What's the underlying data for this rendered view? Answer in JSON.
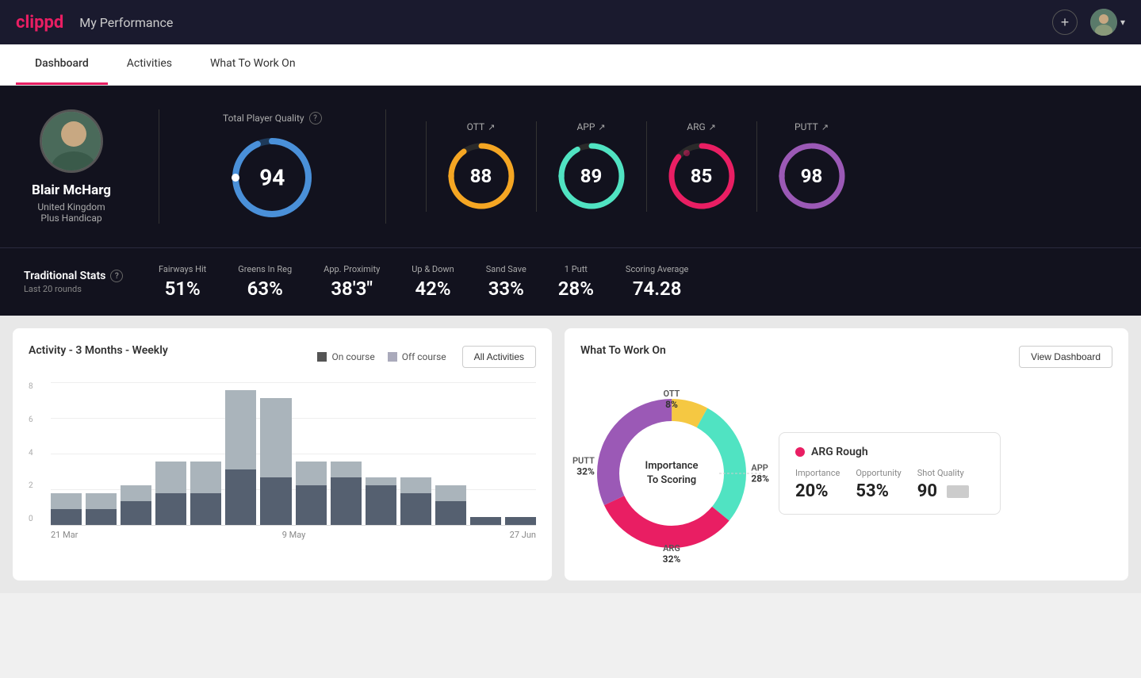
{
  "header": {
    "logo_text": "clippd",
    "title": "My Performance",
    "add_icon": "+",
    "chevron": "▾"
  },
  "nav": {
    "tabs": [
      {
        "label": "Dashboard",
        "active": true
      },
      {
        "label": "Activities",
        "active": false
      },
      {
        "label": "What To Work On",
        "active": false
      }
    ]
  },
  "player": {
    "name": "Blair McHarg",
    "country": "United Kingdom",
    "handicap": "Plus Handicap"
  },
  "quality": {
    "label": "Total Player Quality",
    "main_score": 94,
    "scores": [
      {
        "label": "OTT",
        "value": 88,
        "color": "#f5a623",
        "track": "#333"
      },
      {
        "label": "APP",
        "value": 89,
        "color": "#50e3c2",
        "track": "#333"
      },
      {
        "label": "ARG",
        "value": 85,
        "color": "#e91e63",
        "track": "#333"
      },
      {
        "label": "PUTT",
        "value": 98,
        "color": "#9b59b6",
        "track": "#333"
      }
    ]
  },
  "traditional_stats": {
    "label": "Traditional Stats",
    "sublabel": "Last 20 rounds",
    "items": [
      {
        "name": "Fairways Hit",
        "value": "51%"
      },
      {
        "name": "Greens In Reg",
        "value": "63%"
      },
      {
        "name": "App. Proximity",
        "value": "38'3\""
      },
      {
        "name": "Up & Down",
        "value": "42%"
      },
      {
        "name": "Sand Save",
        "value": "33%"
      },
      {
        "name": "1 Putt",
        "value": "28%"
      },
      {
        "name": "Scoring Average",
        "value": "74.28"
      }
    ]
  },
  "activity_chart": {
    "title": "Activity - 3 Months - Weekly",
    "legend": [
      {
        "label": "On course",
        "color": "dark"
      },
      {
        "label": "Off course",
        "color": "light"
      }
    ],
    "button": "All Activities",
    "y_labels": [
      "8",
      "6",
      "4",
      "2",
      "0"
    ],
    "x_labels": [
      "21 Mar",
      "9 May",
      "27 Jun"
    ],
    "bars": [
      {
        "on": 1,
        "off": 1
      },
      {
        "on": 1,
        "off": 1
      },
      {
        "on": 1.5,
        "off": 1
      },
      {
        "on": 2,
        "off": 2
      },
      {
        "on": 2,
        "off": 2
      },
      {
        "on": 3.5,
        "off": 5
      },
      {
        "on": 3,
        "off": 5
      },
      {
        "on": 2.5,
        "off": 1.5
      },
      {
        "on": 3,
        "off": 1
      },
      {
        "on": 2.5,
        "off": 0.5
      },
      {
        "on": 2,
        "off": 1
      },
      {
        "on": 1.5,
        "off": 1
      },
      {
        "on": 0.5,
        "off": 0
      },
      {
        "on": 0.5,
        "off": 0
      }
    ]
  },
  "what_to_work_on": {
    "title": "What To Work On",
    "button": "View Dashboard",
    "donut_center": "Importance\nTo Scoring",
    "segments": [
      {
        "label": "OTT",
        "percent": "8%",
        "color": "#f5c842",
        "value": 8
      },
      {
        "label": "APP",
        "percent": "28%",
        "color": "#50e3c2",
        "value": 28
      },
      {
        "label": "ARG",
        "percent": "32%",
        "color": "#e91e63",
        "value": 32
      },
      {
        "label": "PUTT",
        "percent": "32%",
        "color": "#9b59b6",
        "value": 32
      }
    ],
    "card": {
      "title": "ARG Rough",
      "dot_color": "#e91e63",
      "columns": [
        {
          "label": "Importance",
          "value": "20%"
        },
        {
          "label": "Opportunity",
          "value": "53%"
        },
        {
          "label": "Shot Quality",
          "value": "90"
        }
      ]
    }
  }
}
